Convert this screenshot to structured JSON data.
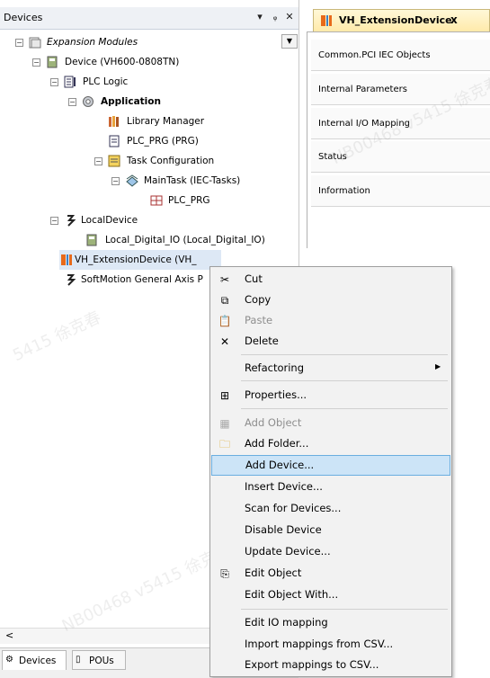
{
  "devices_panel": {
    "title": "Devices",
    "header_controls": {
      "dropdown": "▾",
      "pin": "ᵩ",
      "close": "✕"
    },
    "tree": [
      {
        "label": "Expansion Modules",
        "style": "italic"
      },
      {
        "label": "Device (VH600-0808TN)"
      },
      {
        "label": "PLC Logic"
      },
      {
        "label": "Application",
        "style": "bold"
      },
      {
        "label": "Library Manager"
      },
      {
        "label": "PLC_PRG (PRG)"
      },
      {
        "label": "Task Configuration"
      },
      {
        "label": "MainTask (IEC-Tasks)"
      },
      {
        "label": "PLC_PRG"
      },
      {
        "label": "LocalDevice"
      },
      {
        "label": "Local_Digital_IO (Local_Digital_IO)"
      },
      {
        "label": "VH_ExtensionDevice (VH_"
      },
      {
        "label": "SoftMotion General Axis P"
      }
    ],
    "bottom_tabs": [
      "Devices",
      "POUs"
    ],
    "scroll_left": "<"
  },
  "editor": {
    "tab_label": "VH_ExtensionDevice",
    "tab_close": "x",
    "nav_items": [
      "Common.PCI IEC Objects",
      "Internal Parameters",
      "Internal I/O Mapping",
      "Status",
      "Information"
    ]
  },
  "context_menu": {
    "items": [
      {
        "label": "Cut",
        "icon": "scissors-icon",
        "glyph": "✂"
      },
      {
        "label": "Copy",
        "icon": "copy-icon",
        "glyph": "⧉"
      },
      {
        "label": "Paste",
        "icon": "paste-icon",
        "glyph": "📋",
        "disabled": true
      },
      {
        "label": "Delete",
        "icon": "delete-icon",
        "glyph": "✕"
      },
      {
        "label": "Refactoring",
        "submenu": true
      },
      {
        "label": "Properties...",
        "icon": "properties-icon",
        "glyph": "⊞"
      },
      {
        "label": "Add Object",
        "icon": "add-object-icon",
        "glyph": "▦",
        "disabled": true
      },
      {
        "label": "Add Folder...",
        "icon": "folder-icon",
        "glyph": "🗀"
      },
      {
        "label": "Add Device...",
        "highlight": true
      },
      {
        "label": "Insert Device..."
      },
      {
        "label": "Scan for Devices..."
      },
      {
        "label": "Disable Device"
      },
      {
        "label": "Update Device..."
      },
      {
        "label": "Edit Object",
        "icon": "edit-object-icon",
        "glyph": "⎘"
      },
      {
        "label": "Edit Object With..."
      },
      {
        "label": "Edit IO mapping"
      },
      {
        "label": "Import mappings from CSV..."
      },
      {
        "label": "Export mappings to CSV..."
      }
    ]
  },
  "watermarks": [
    "NB00468 v5415 徐克春",
    "5415 徐克春",
    "NB00468 v5415 徐克春"
  ]
}
